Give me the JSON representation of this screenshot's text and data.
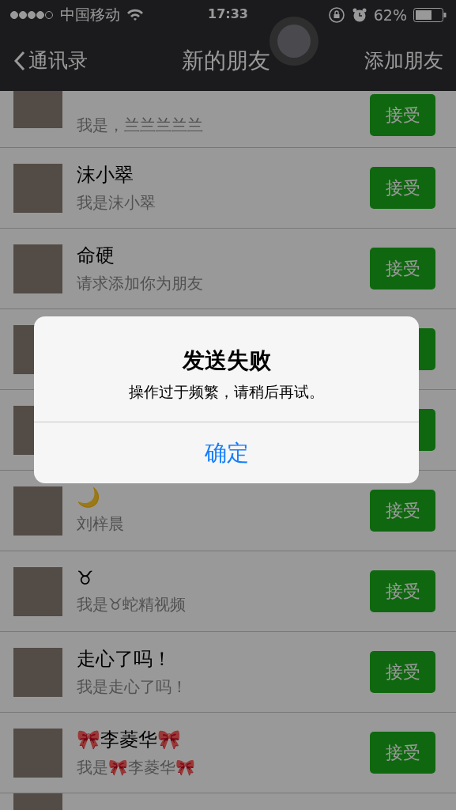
{
  "status_bar": {
    "carrier": "中国移动",
    "time": "17:33",
    "battery": "62%"
  },
  "nav": {
    "back": "通讯录",
    "title": "新的朋友",
    "action": "添加朋友"
  },
  "requests": [
    {
      "kind": "top-cut",
      "subtitle": "我是，兰兰兰兰兰",
      "button": "接受"
    },
    {
      "kind": "full",
      "name": "沫小翠",
      "subtitle": "我是沫小翠",
      "button": "接受"
    },
    {
      "kind": "full",
      "name": "命硬",
      "subtitle": "请求添加你为朋友",
      "button": "接受"
    },
    {
      "kind": "covered"
    },
    {
      "kind": "covered"
    },
    {
      "kind": "full",
      "name": "🌙",
      "subtitle": "刘梓晨",
      "button": "接受"
    },
    {
      "kind": "full",
      "name": "♉",
      "subtitle": "我是♉蛇精视频",
      "button": "接受"
    },
    {
      "kind": "full",
      "name": "走心了吗！",
      "subtitle": "我是走心了吗！",
      "button": "接受"
    },
    {
      "kind": "full",
      "name": "🎀李菱华🎀",
      "subtitle": "我是🎀李菱华🎀",
      "button": "接受"
    },
    {
      "kind": "bottom-cut"
    }
  ],
  "alert": {
    "title": "发送失败",
    "message": "操作过于频繁，请稍后再试。",
    "button": "确定"
  }
}
